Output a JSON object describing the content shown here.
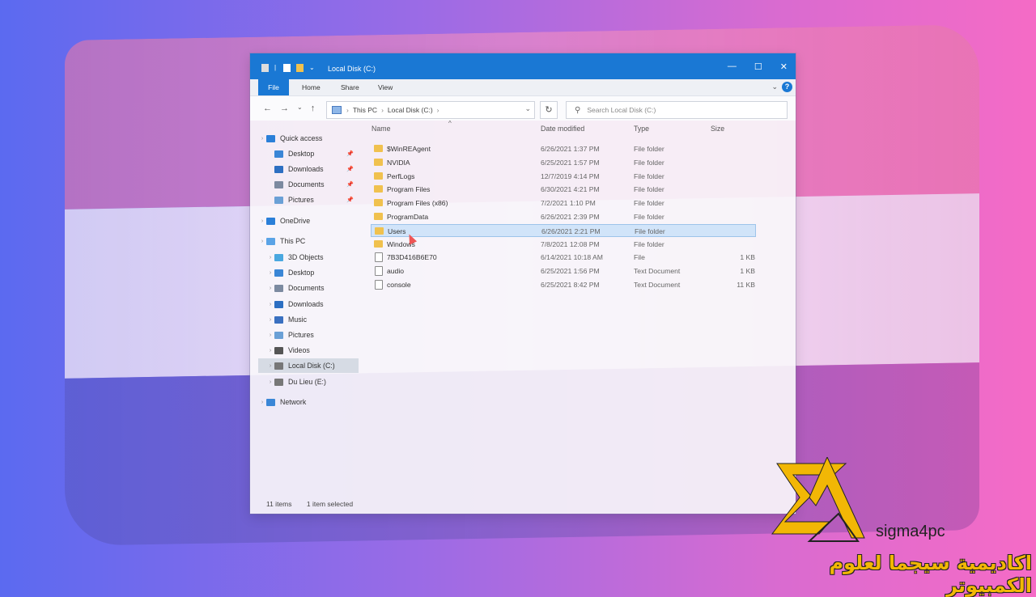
{
  "window": {
    "title": "Local Disk (C:)",
    "controls": {
      "minimize": "—",
      "maximize": "☐",
      "close": "✕"
    }
  },
  "ribbon": {
    "tabs": [
      "File",
      "Home",
      "Share",
      "View"
    ],
    "help": "?",
    "collapse": "⌄"
  },
  "nav": {
    "back": "←",
    "forward": "→",
    "recent": "⌄",
    "up": "↑",
    "path": [
      "This PC",
      "Local Disk (C:)"
    ],
    "path_sep": "›",
    "dropdown": "⌄",
    "refresh": "↻",
    "search_placeholder": "Search Local Disk (C:)"
  },
  "sidebar": {
    "items": [
      {
        "label": "Quick access",
        "icon": "star-icon",
        "color": "#2a7fd8"
      },
      {
        "label": "Desktop",
        "icon": "desktop-icon",
        "color": "#3a86d6",
        "pinned": true
      },
      {
        "label": "Downloads",
        "icon": "download-icon",
        "color": "#2c6fc2",
        "pinned": true
      },
      {
        "label": "Documents",
        "icon": "documents-icon",
        "color": "#7c8aa0",
        "pinned": true
      },
      {
        "label": "Pictures",
        "icon": "pictures-icon",
        "color": "#6aa0d6",
        "pinned": true
      },
      {
        "label": "OneDrive",
        "icon": "cloud-icon",
        "color": "#2a7fd8"
      },
      {
        "label": "This PC",
        "icon": "computer-icon",
        "color": "#5aa3e6"
      },
      {
        "label": "3D Objects",
        "icon": "cube-icon",
        "color": "#4aa8e0"
      },
      {
        "label": "Desktop",
        "icon": "desktop-icon",
        "color": "#3a86d6"
      },
      {
        "label": "Documents",
        "icon": "documents-icon",
        "color": "#7c8aa0"
      },
      {
        "label": "Downloads",
        "icon": "download-icon",
        "color": "#2c6fc2"
      },
      {
        "label": "Music",
        "icon": "music-icon",
        "color": "#3a70c0"
      },
      {
        "label": "Pictures",
        "icon": "pictures-icon",
        "color": "#6aa0d6"
      },
      {
        "label": "Videos",
        "icon": "videos-icon",
        "color": "#555"
      },
      {
        "label": "Local Disk (C:)",
        "icon": "drive-icon",
        "color": "#777",
        "selected": true
      },
      {
        "label": "Du Lieu (E:)",
        "icon": "drive-icon",
        "color": "#777"
      },
      {
        "label": "Network",
        "icon": "network-icon",
        "color": "#3a86d6"
      }
    ]
  },
  "columns": {
    "name": "Name",
    "date": "Date modified",
    "type": "Type",
    "size": "Size",
    "sort": "^"
  },
  "files": [
    {
      "name": "$WinREAgent",
      "date": "6/26/2021 1:37 PM",
      "type": "File folder",
      "size": "",
      "kind": "folder"
    },
    {
      "name": "NVIDIA",
      "date": "6/25/2021 1:57 PM",
      "type": "File folder",
      "size": "",
      "kind": "folder"
    },
    {
      "name": "PerfLogs",
      "date": "12/7/2019 4:14 PM",
      "type": "File folder",
      "size": "",
      "kind": "folder"
    },
    {
      "name": "Program Files",
      "date": "6/30/2021 4:21 PM",
      "type": "File folder",
      "size": "",
      "kind": "folder"
    },
    {
      "name": "Program Files (x86)",
      "date": "7/2/2021 1:10 PM",
      "type": "File folder",
      "size": "",
      "kind": "folder"
    },
    {
      "name": "ProgramData",
      "date": "6/26/2021 2:39 PM",
      "type": "File folder",
      "size": "",
      "kind": "folder"
    },
    {
      "name": "Users",
      "date": "6/26/2021 2:21 PM",
      "type": "File folder",
      "size": "",
      "kind": "folder",
      "selected": true
    },
    {
      "name": "Windows",
      "date": "7/8/2021 12:08 PM",
      "type": "File folder",
      "size": "",
      "kind": "folder"
    },
    {
      "name": "7B3D416B6E70",
      "date": "6/14/2021 10:18 AM",
      "type": "File",
      "size": "1 KB",
      "kind": "file"
    },
    {
      "name": "audio",
      "date": "6/25/2021 1:56 PM",
      "type": "Text Document",
      "size": "1 KB",
      "kind": "file"
    },
    {
      "name": "console",
      "date": "6/25/2021 8:42 PM",
      "type": "Text Document",
      "size": "11 KB",
      "kind": "file"
    }
  ],
  "status": {
    "count": "11 items",
    "selection": "1 item selected"
  },
  "branding": {
    "name": "sigma4pc",
    "arabic": "اكاديمية سيجما لعلوم الكمبيوتر",
    "logo_color": "#f2b705"
  }
}
